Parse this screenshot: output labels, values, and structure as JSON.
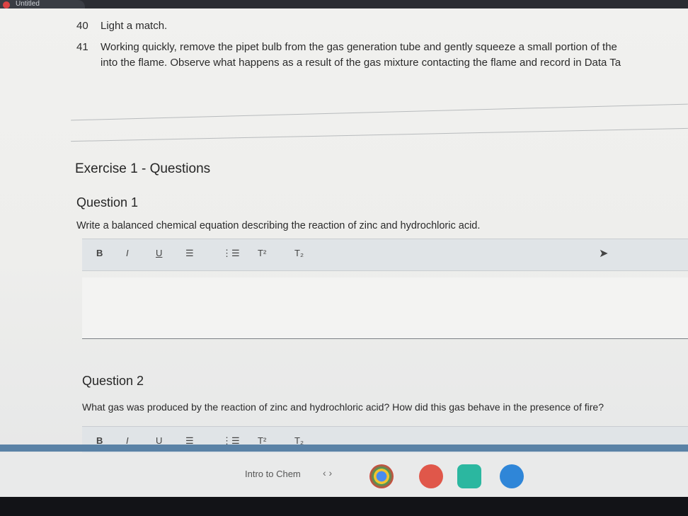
{
  "browser": {
    "tab_title": "Untitled"
  },
  "steps": [
    {
      "number": "40",
      "text": "Light a match."
    },
    {
      "number": "41",
      "text": "Working quickly, remove the pipet bulb from the gas generation tube and gently squeeze a small portion of the",
      "text2": "into the flame. Observe what happens as a result of the gas mixture contacting the flame and record in Data Ta"
    }
  ],
  "exercise": {
    "heading": "Exercise 1 - Questions"
  },
  "questions": [
    {
      "label": "Question 1",
      "prompt": "Write a balanced chemical equation describing the reaction of zinc and hydrochloric acid."
    },
    {
      "label": "Question 2",
      "prompt": "What gas was produced by the reaction of zinc and hydrochloric acid? How did this gas behave in the presence of fire?"
    }
  ],
  "toolbar": {
    "bold": "B",
    "italic": "I",
    "underline": "U",
    "bullet_list": "☰",
    "numbered_list": "⋮☰",
    "superscript": "T²",
    "subscript": "T₂"
  },
  "shelf": {
    "window_label": "Intro to Chem",
    "nav_arrows": "‹  ›"
  },
  "colors": {
    "accent_blue": "#5a82a6",
    "page_bg": "#efefed"
  }
}
